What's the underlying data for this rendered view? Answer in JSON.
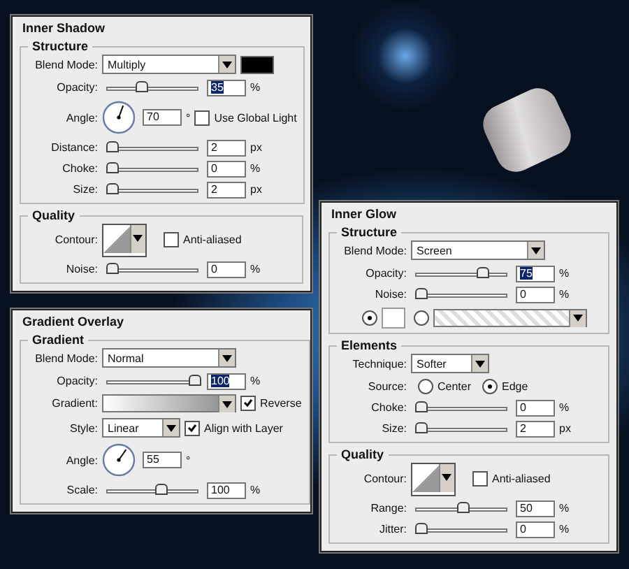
{
  "panels": [
    {
      "title": "Inner Shadow",
      "sections": [
        {
          "title": "Structure",
          "rows": [
            {
              "kind": "select",
              "label": "Blend Mode:",
              "value": "Multiply",
              "swatch": true
            },
            {
              "kind": "slider",
              "label": "Opacity:",
              "level": 0.35,
              "value": "35",
              "unit": "%",
              "highlighted": true
            },
            {
              "kind": "angle",
              "label": "Angle:",
              "value": "70",
              "unit": "°",
              "checkbox": {
                "label": "Use Global Light",
                "checked": false
              }
            },
            {
              "kind": "slider",
              "label": "Distance:",
              "level": 0,
              "value": "2",
              "unit": "px"
            },
            {
              "kind": "slider",
              "label": "Choke:",
              "level": 0,
              "value": "0",
              "unit": "%"
            },
            {
              "kind": "slider",
              "label": "Size:",
              "level": 0,
              "value": "2",
              "unit": "px"
            }
          ]
        },
        {
          "title": "Quality",
          "rows": [
            {
              "kind": "contour",
              "label": "Contour:",
              "checkbox": {
                "label": "Anti-aliased",
                "checked": false
              }
            },
            {
              "kind": "slider",
              "label": "Noise:",
              "level": 0,
              "value": "0",
              "unit": "%"
            }
          ]
        }
      ]
    },
    {
      "title": "Gradient Overlay",
      "sections": [
        {
          "title": "Gradient",
          "rows": [
            {
              "kind": "select",
              "label": "Blend Mode:",
              "value": "Normal"
            },
            {
              "kind": "slider",
              "label": "Opacity:",
              "level": 1,
              "value": "100",
              "unit": "%",
              "highlighted": true
            },
            {
              "kind": "gradient",
              "label": "Gradient:",
              "checkbox": {
                "label": "Reverse",
                "checked": true
              }
            },
            {
              "kind": "select",
              "label": "Style:",
              "value": "Linear",
              "narrow": true,
              "checkbox": {
                "label": "Align with Layer",
                "checked": true
              }
            },
            {
              "kind": "angle",
              "label": "Angle:",
              "value": "55",
              "unit": "°"
            },
            {
              "kind": "slider",
              "label": "Scale:",
              "level": 0.6,
              "value": "100",
              "unit": "%"
            }
          ]
        }
      ]
    },
    {
      "title": "Inner Glow",
      "sections": [
        {
          "title": "Structure",
          "rows": [
            {
              "kind": "select",
              "label": "Blend Mode:",
              "value": "Screen"
            },
            {
              "kind": "slider",
              "label": "Opacity:",
              "level": 0.75,
              "value": "75",
              "unit": "%",
              "highlighted": true
            },
            {
              "kind": "slider",
              "label": "Noise:",
              "level": 0,
              "value": "0",
              "unit": "%"
            },
            {
              "kind": "fill_choice",
              "options": [
                {
                  "kind": "color",
                  "selected": true
                },
                {
                  "kind": "gradient",
                  "selected": false
                }
              ]
            }
          ]
        },
        {
          "title": "Elements",
          "rows": [
            {
              "kind": "select",
              "label": "Technique:",
              "value": "Softer",
              "narrow": true
            },
            {
              "kind": "radios",
              "label": "Source:",
              "options": [
                {
                  "label": "Center",
                  "selected": false
                },
                {
                  "label": "Edge",
                  "selected": true
                }
              ]
            },
            {
              "kind": "slider",
              "label": "Choke:",
              "level": 0,
              "value": "0",
              "unit": "%"
            },
            {
              "kind": "slider",
              "label": "Size:",
              "level": 0,
              "value": "2",
              "unit": "px"
            }
          ]
        },
        {
          "title": "Quality",
          "rows": [
            {
              "kind": "contour",
              "label": "Contour:",
              "checkbox": {
                "label": "Anti-aliased",
                "checked": false
              }
            },
            {
              "kind": "slider",
              "label": "Range:",
              "level": 0.5,
              "value": "50",
              "unit": "%"
            },
            {
              "kind": "slider",
              "label": "Jitter:",
              "level": 0,
              "value": "0",
              "unit": "%"
            }
          ]
        }
      ]
    }
  ]
}
